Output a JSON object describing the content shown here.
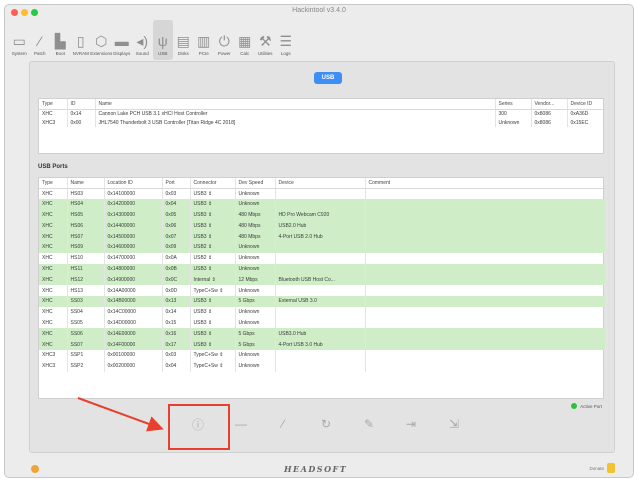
{
  "window": {
    "title": "Hackintool v3.4.0"
  },
  "toolbar": {
    "items": [
      {
        "label": "System",
        "icon": "system-icon",
        "glyph": "▭"
      },
      {
        "label": "Patch",
        "icon": "patch-icon",
        "glyph": "⁄"
      },
      {
        "label": "Boot",
        "icon": "boot-icon",
        "glyph": "▙"
      },
      {
        "label": "NVRAM",
        "icon": "nvram-icon",
        "glyph": "▯"
      },
      {
        "label": "Extensions",
        "icon": "extensions-icon",
        "glyph": "⬡"
      },
      {
        "label": "Displays",
        "icon": "displays-icon",
        "glyph": "▬"
      },
      {
        "label": "Sound",
        "icon": "sound-icon",
        "glyph": "◂)"
      },
      {
        "label": "USB",
        "icon": "usb-icon",
        "glyph": "ψ",
        "active": true
      },
      {
        "label": "Disks",
        "icon": "disks-icon",
        "glyph": "▤"
      },
      {
        "label": "PCIe",
        "icon": "pcie-icon",
        "glyph": "▥"
      },
      {
        "label": "Power",
        "icon": "power-icon",
        "glyph": "⏻"
      },
      {
        "label": "Calc",
        "icon": "calc-icon",
        "glyph": "▦"
      },
      {
        "label": "Utilities",
        "icon": "utilities-icon",
        "glyph": "⚒"
      },
      {
        "label": "Logs",
        "icon": "logs-icon",
        "glyph": "☰"
      }
    ]
  },
  "segment": {
    "label": "USB"
  },
  "controllers": {
    "headers": [
      "Type",
      "ID",
      "Name",
      "Series",
      "Vendor...",
      "Device ID"
    ],
    "rows": [
      [
        "XHC",
        "0x14",
        "Cannon Lake PCH USB 3.1 xHCI Host Controller",
        "300",
        "0x8086",
        "0xA36D"
      ],
      [
        "XHC3",
        "0x00",
        "JHL7540 Thunderbolt 3 USB Controller [Titan Ridge 4C 2018]",
        "Unknown",
        "0x8086",
        "0x15EC"
      ]
    ]
  },
  "ports_section": {
    "title": "USB Ports"
  },
  "ports": {
    "headers": [
      "Type",
      "Name",
      "Location ID",
      "Port",
      "Connector",
      "Dev Speed",
      "Device",
      "Comment"
    ],
    "rows": [
      {
        "green": false,
        "cells": [
          "XHC",
          "HS03",
          "0x14100000",
          "0x03",
          "USB3",
          "Unknown",
          "",
          ""
        ]
      },
      {
        "green": true,
        "cells": [
          "XHC",
          "HS04",
          "0x14200000",
          "0x04",
          "USB3",
          "Unknown",
          "",
          ""
        ]
      },
      {
        "green": true,
        "cells": [
          "XHC",
          "HS05",
          "0x14300000",
          "0x05",
          "USB3",
          "480 Mbps",
          "HD Pro Webcam C920",
          ""
        ]
      },
      {
        "green": true,
        "cells": [
          "XHC",
          "HS06",
          "0x14400000",
          "0x06",
          "USB3",
          "480 Mbps",
          "USB2.0 Hub",
          ""
        ]
      },
      {
        "green": true,
        "cells": [
          "XHC",
          "HS07",
          "0x14500000",
          "0x07",
          "USB3",
          "480 Mbps",
          "4-Port USB 2.0 Hub",
          ""
        ]
      },
      {
        "green": true,
        "cells": [
          "XHC",
          "HS09",
          "0x14600000",
          "0x09",
          "USB2",
          "Unknown",
          "",
          ""
        ]
      },
      {
        "green": false,
        "cells": [
          "XHC",
          "HS10",
          "0x14700000",
          "0x0A",
          "USB2",
          "Unknown",
          "",
          ""
        ]
      },
      {
        "green": true,
        "cells": [
          "XHC",
          "HS11",
          "0x14800000",
          "0x0B",
          "USB3",
          "Unknown",
          "",
          ""
        ]
      },
      {
        "green": true,
        "cells": [
          "XHC",
          "HS12",
          "0x14900000",
          "0x0C",
          "Internal",
          "12 Mbps",
          "Bluetooth USB Host Co...",
          ""
        ]
      },
      {
        "green": false,
        "cells": [
          "XHC",
          "HS13",
          "0x14A00000",
          "0x0D",
          "TypeC+Sw",
          "Unknown",
          "",
          ""
        ]
      },
      {
        "green": true,
        "cells": [
          "XHC",
          "SS03",
          "0x14B00000",
          "0x13",
          "USB3",
          "5 Gbps",
          "External USB 3.0",
          ""
        ]
      },
      {
        "green": false,
        "cells": [
          "XHC",
          "SS04",
          "0x14C00000",
          "0x14",
          "USB3",
          "Unknown",
          "",
          ""
        ]
      },
      {
        "green": false,
        "cells": [
          "XHC",
          "SS05",
          "0x14D00000",
          "0x15",
          "USB3",
          "Unknown",
          "",
          ""
        ]
      },
      {
        "green": true,
        "cells": [
          "XHC",
          "SS06",
          "0x14E00000",
          "0x16",
          "USB3",
          "5 Gbps",
          "USB3.0 Hub",
          ""
        ]
      },
      {
        "green": true,
        "cells": [
          "XHC",
          "SS07",
          "0x14F00000",
          "0x17",
          "USB3",
          "5 Gbps",
          "4-Port USB 3.0 Hub",
          ""
        ]
      },
      {
        "green": false,
        "cells": [
          "XHC3",
          "SSP1",
          "0x00100000",
          "0x03",
          "TypeC+Sw",
          "Unknown",
          "",
          ""
        ]
      },
      {
        "green": false,
        "cells": [
          "XHC3",
          "SSP2",
          "0x00200000",
          "0x04",
          "TypeC+Sw",
          "Unknown",
          "",
          ""
        ]
      }
    ]
  },
  "status": {
    "label": "Active Port"
  },
  "actions": [
    {
      "name": "info-icon",
      "glyph": "ⓘ"
    },
    {
      "name": "remove-icon",
      "glyph": "—"
    },
    {
      "name": "clean-icon",
      "glyph": "⁄"
    },
    {
      "name": "refresh-icon",
      "glyph": "↻"
    },
    {
      "name": "edit-icon",
      "glyph": "✎"
    },
    {
      "name": "import-icon",
      "glyph": "⇥"
    },
    {
      "name": "export-icon",
      "glyph": "⇲"
    }
  ],
  "footer": {
    "brand": "HEADSOFT",
    "donate_label": "Donate"
  },
  "annotation": {
    "color": "#e8402f"
  }
}
